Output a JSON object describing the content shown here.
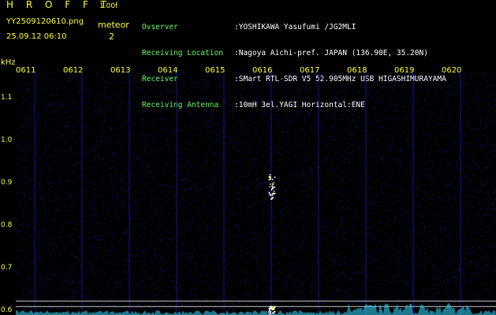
{
  "header": {
    "brand": "H R O F F T",
    "version": "1.00f",
    "filename": "YY2509120610.png",
    "timestamp": "25.09.12 06:10",
    "meteor_label": "meteor",
    "meteor_count": "2",
    "meta": [
      {
        "label": "Ovserver",
        "value": ":YOSHIKAWA Yasufumi /JG2MLI"
      },
      {
        "label": "Receiving Location",
        "value": ":Nagoya Aichi-pref. JAPAN (136.90E, 35.20N)"
      },
      {
        "label": "Receiver",
        "value": ":SMart RTL-SDR V5 52.905MHz USB HIGASHIMURAYAMA"
      },
      {
        "label": "Receiving Antenna",
        "value": ":10mH 3el.YAGI Horizontal:ENE"
      }
    ]
  },
  "colors": {
    "label_yellow": "#ffff33",
    "meta_green": "#5dff5d",
    "noise_blue": "#1a2aff",
    "baseline_cyan": "#33ddff",
    "echo_white": "#ffffff",
    "echo_yellow": "#ffff00"
  },
  "chart_data": {
    "type": "heatmap",
    "title": "",
    "ylabel": "kHz",
    "xlabel": "",
    "y_tick_labels": [
      "1.1",
      "1.0",
      "0.9",
      "0.8",
      "0.7",
      "0.6"
    ],
    "y_ticks": [
      1.1,
      1.0,
      0.9,
      0.8,
      0.7,
      0.6
    ],
    "ylim": [
      0.587,
      1.18
    ],
    "x_tick_labels": [
      "0611",
      "0612",
      "0613",
      "0614",
      "0615",
      "0616",
      "0617",
      "0618",
      "0619",
      "0620"
    ],
    "x_ticks": [
      611,
      612,
      613,
      614,
      615,
      616,
      617,
      618,
      619,
      620
    ],
    "xlim": [
      610.6,
      620.75
    ],
    "reference_lines_khz": [
      0.62,
      0.607
    ],
    "meteor_echoes": [
      {
        "time": 616.0,
        "freq_khz": 0.89,
        "spread_khz": 0.03
      },
      {
        "time": 616.0,
        "freq_khz": 0.6,
        "spread_khz": 0.01
      }
    ]
  }
}
